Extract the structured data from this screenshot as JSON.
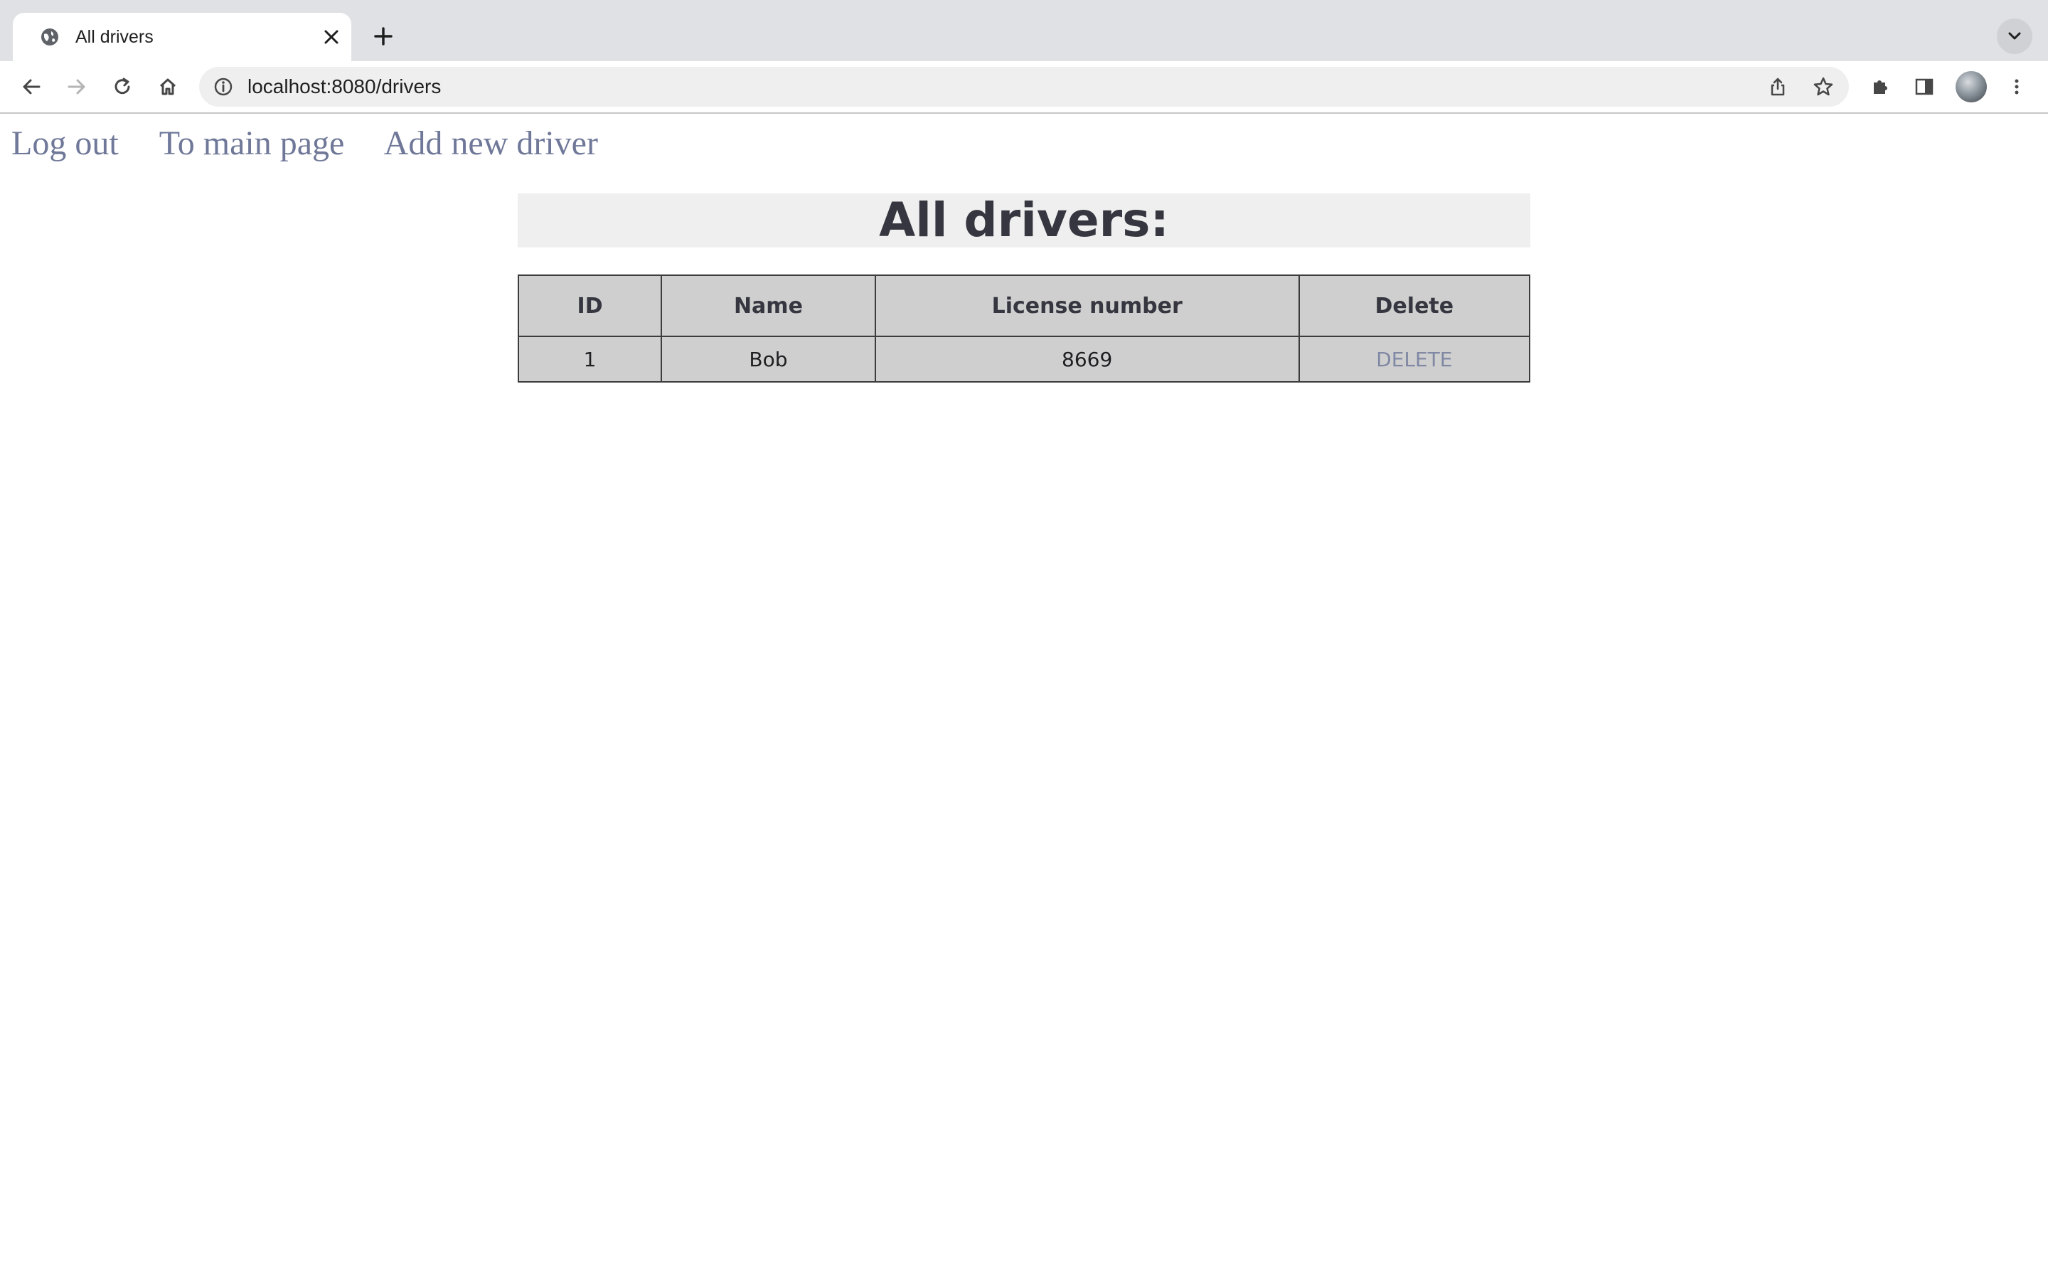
{
  "browser": {
    "tab": {
      "title": "All drivers"
    },
    "address_bar": {
      "url": "localhost:8080/drivers"
    }
  },
  "page": {
    "nav_links": [
      {
        "label": "Log out"
      },
      {
        "label": "To main page"
      },
      {
        "label": "Add new driver"
      }
    ],
    "heading": "All drivers:",
    "table": {
      "headers": [
        "ID",
        "Name",
        "License number",
        "Delete"
      ],
      "rows": [
        {
          "id": "1",
          "name": "Bob",
          "license_number": "8669",
          "delete_label": "DELETE"
        }
      ]
    }
  },
  "colors": {
    "link": "#6f7898",
    "table_bg": "#cfcfcf",
    "heading_bg": "#efefef",
    "heading_text": "#35363f"
  }
}
